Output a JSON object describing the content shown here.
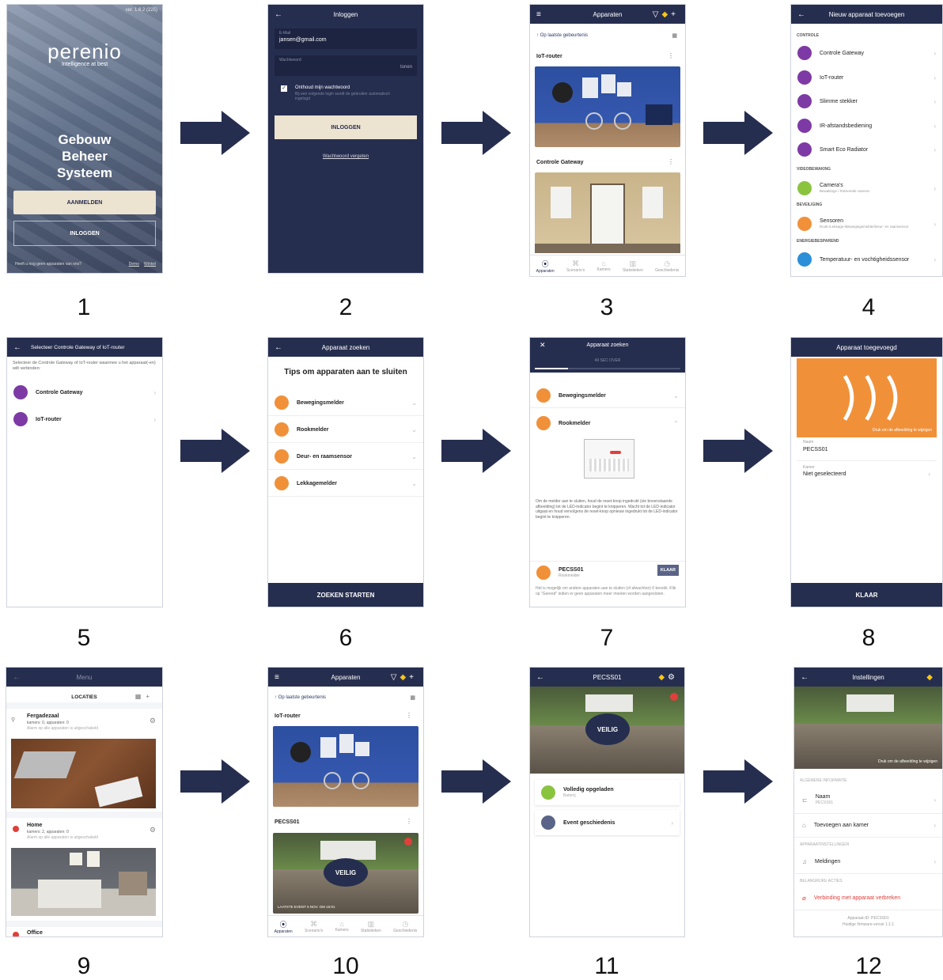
{
  "steps": [
    "1",
    "2",
    "3",
    "4",
    "5",
    "6",
    "7",
    "8",
    "9",
    "10",
    "11",
    "12"
  ],
  "colors": {
    "navy": "#262e4f",
    "beige": "#ece3d0",
    "orange": "#f0913a",
    "purple": "#7d3aa5",
    "green": "#8ac43f",
    "blue": "#2a8fd8",
    "red": "#e0403a"
  },
  "s1": {
    "version": "ver. 1.6.2 (225)",
    "brand": "perenio",
    "tagline": "Intelligence at best",
    "title1": "Gebouw",
    "title2": "Beheer",
    "title3": "Systeem",
    "btn_signup": "AANMELDEN",
    "btn_login": "INLOGGEN",
    "footer": "Heeft u nog geen apparaten van ons?",
    "demo": "Demo",
    "shop": "Winkel"
  },
  "s2": {
    "title": "Inloggen",
    "email_label": "E-Mail",
    "email_value": "jansen@gmail.com",
    "pw_label": "Wachtwoord",
    "pw_show": "tonen",
    "remember": "Onthoud mijn wachtwoord",
    "remember_sub": "Bij een volgende login wordt de gebruiker automatisch ingelogd",
    "btn": "INLOGGEN",
    "forgot": "Wachtwoord vergeten"
  },
  "s3": {
    "title": "Apparaten",
    "latest": "Op laatste gebeurtenis",
    "card1": "IoT-router",
    "card2": "Controle Gateway",
    "tabs": [
      "Apparaten",
      "Scenario's",
      "Kamers",
      "Statistieken",
      "Geschiedenis"
    ]
  },
  "s4": {
    "title": "Nieuw apparaat toevoegen",
    "sec1": "CONTROLE",
    "items1": [
      "Controle Gateway",
      "IoT-router",
      "Slimme stekker",
      "IR-afstandsbediening",
      "Smart Eco Radiator"
    ],
    "sec2": "VIDEOBEWAKING",
    "cam": "Camera's",
    "cam_sub": "Bewakings / Roterende camera",
    "sec3": "BEVEILIGING",
    "sens": "Sensoren",
    "sens_sub": "Rook-/Lekkage-/Bewegingsmelder/Deur- en raamsensor",
    "sec4": "ENERGIEBESPAREND",
    "temp": "Temperatuur- en vochtigheidssensor"
  },
  "s5": {
    "title": "Selecteer Controle Gateway of IoT-router",
    "desc": "Selecteer de Controle Gateway of IoT-router waarmee u het apparaat(-en) wilt verbinden:",
    "items": [
      "Controle Gateway",
      "IoT-router"
    ]
  },
  "s6": {
    "title": "Apparaat zoeken",
    "heading": "Tips om apparaten aan te sluiten",
    "items": [
      "Bewegingsmelder",
      "Rookmelder",
      "Deur- en raamsensor",
      "Lekkagemelder"
    ],
    "btn": "ZOEKEN STARTEN"
  },
  "s7": {
    "title": "Apparaat zoeken",
    "timer": "49 SEC OVER",
    "items": [
      "Bewegingsmelder",
      "Rookmelder"
    ],
    "text": "Om de melder aan te sluiten, houd de reset-knop ingedrukt (zie bovenstaande afbeelding) tot de LED-indicator begint te knipperen. Wacht tot de LED-indicator uitgaat en houd vervolgens de reset-knop opnieuw ingedrukt tot de LED-indicator begint te knipperen.",
    "device": "PECSS01",
    "device_sub": "Rookmelder",
    "btn": "KLAAR",
    "foot": "Het is mogelijk om andere apparaten aan te sluiten (of afwachten) 0 bereikt. Klik op \"Gereed\" indien er geen apparaten meer moeten worden aangesloten."
  },
  "s8": {
    "title": "Apparaat toegevoegd",
    "hint": "Druk om de afbeelding te wijzigen",
    "name_label": "Naam",
    "name_value": "PECSS01",
    "room_label": "Kamer",
    "room_value": "Niet geselecteerd",
    "btn": "KLAAR"
  },
  "s9": {
    "title": "Menu",
    "locations": "LOCATIES",
    "loc1": "Fergadezaal",
    "loc1_sub": "kamers: 0, apparaten: 0",
    "loc1_sub2": "Alarm op alle apparaten is uitgeschakeld",
    "loc2": "Home",
    "loc2_sub": "kamers: 2, apparaten: 0",
    "loc2_sub2": "Alarm op alle apparaten is uitgeschakeld",
    "loc3": "Office"
  },
  "s10": {
    "title": "Apparaten",
    "latest": "Op laatste gebeurtenis",
    "card1": "IoT-router",
    "card2": "PECSS01",
    "safe": "VEILIG",
    "last_event": "LAATSTE EVENT 5 NOV. OM 16:01",
    "tabs": [
      "Apparaten",
      "Scenario's",
      "Kamers",
      "Statistieken",
      "Geschiedenis"
    ]
  },
  "s11": {
    "title": "PECSS01",
    "safe": "VEILIG",
    "item1": "Volledig opgeladen",
    "item1_sub": "Batterij",
    "item2": "Event geschiedenis"
  },
  "s12": {
    "title": "Instellingen",
    "hint": "Druk om de afbeelding te wijzigen",
    "sec1": "ALGEMENE INFORMATIE",
    "name": "Naam",
    "name_sub": "PECSS01",
    "room": "Toevoegen aan kamer",
    "sec2": "APPARAATINSTELLINGEN",
    "notif": "Meldingen",
    "sec3": "BELANGRIJKE ACTIES",
    "disconnect": "Verbinding met apparaat verbreken",
    "id": "Apparaat-ID: PECSS01",
    "fw": "Huidige firmware-versie 1.1.1"
  }
}
